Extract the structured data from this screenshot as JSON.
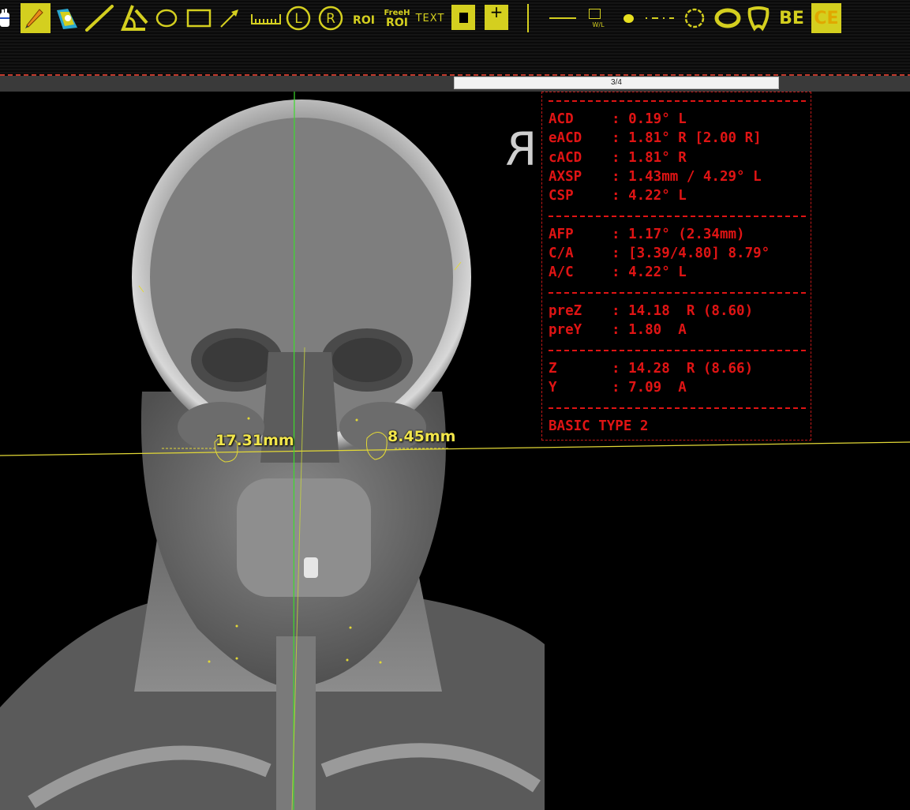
{
  "toolbar": {
    "tools": [
      {
        "name": "hand-icon"
      },
      {
        "name": "pencil-icon"
      },
      {
        "name": "annotate-icon"
      },
      {
        "name": "line-icon"
      },
      {
        "name": "angle-icon"
      },
      {
        "name": "ellipse-icon"
      },
      {
        "name": "rectangle-icon"
      },
      {
        "name": "arrow-icon"
      },
      {
        "name": "ruler-icon"
      },
      {
        "name": "left-marker-icon",
        "label": "L"
      },
      {
        "name": "right-marker-icon",
        "label": "R"
      },
      {
        "name": "roi-icon",
        "label": "ROI"
      },
      {
        "name": "freehand-roi-icon",
        "label_top": "FreeH",
        "label": "ROI"
      },
      {
        "name": "text-icon",
        "label": "TEXT"
      },
      {
        "name": "fill-square-icon"
      },
      {
        "name": "plus-icon",
        "label": "+"
      },
      {
        "name": "line-style-icon"
      },
      {
        "name": "window-level-icon",
        "label": "W/L"
      },
      {
        "name": "dot-icon"
      },
      {
        "name": "dash-icon"
      },
      {
        "name": "circle-dashed-icon"
      },
      {
        "name": "ring-icon"
      },
      {
        "name": "shape-icon"
      },
      {
        "name": "be-button",
        "label": "BE"
      },
      {
        "name": "ce-button",
        "label": "CE"
      }
    ],
    "accent": "#d4cf1f"
  },
  "page_indicator": "3/4",
  "orientation_marker": "R",
  "measurements": {
    "left": "17.31mm",
    "right": "8.45mm"
  },
  "results": {
    "color": "#e01414",
    "groups": [
      [
        {
          "key": "ACD",
          "value": ": 0.19° L"
        },
        {
          "key": "eACD",
          "value": ": 1.81° R [2.00 R]"
        },
        {
          "key": "cACD",
          "value": ": 1.81° R"
        },
        {
          "key": "AXSP",
          "value": ": 1.43mm / 4.29° L"
        },
        {
          "key": "CSP",
          "value": ": 4.22° L"
        }
      ],
      [
        {
          "key": "AFP",
          "value": ": 1.17° (2.34mm)"
        },
        {
          "key": "C/A",
          "value": ": [3.39/4.80] 8.79°"
        },
        {
          "key": "A/C",
          "value": ": 4.22° L"
        }
      ],
      [
        {
          "key": "preZ",
          "value": ": 14.18  R (8.60)"
        },
        {
          "key": "preY",
          "value": ": 1.80  A"
        }
      ],
      [
        {
          "key": "Z",
          "value": ": 14.28  R (8.66)"
        },
        {
          "key": "Y",
          "value": ": 7.09  A"
        }
      ]
    ],
    "summary": "BASIC TYPE 2"
  }
}
